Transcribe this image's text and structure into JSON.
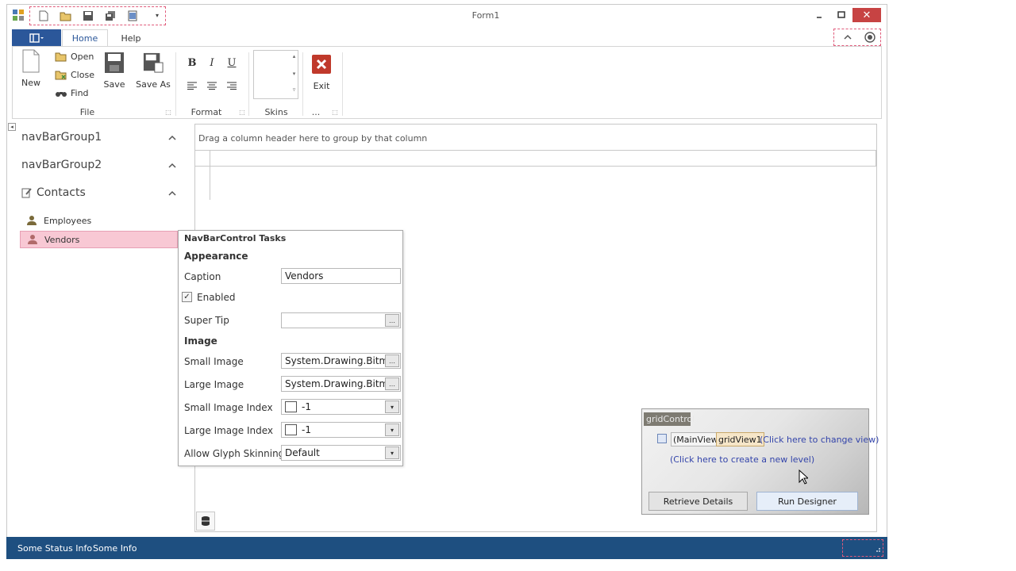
{
  "window": {
    "title": "Form1",
    "minimize_icon": "minimize-icon",
    "maximize_icon": "maximize-icon",
    "close_icon": "close-icon"
  },
  "quick_access": [
    "new-doc-icon",
    "open-folder-icon",
    "save-icon",
    "save-all-icon",
    "print-icon",
    "customize-dropdown-icon"
  ],
  "ribbon": {
    "tabs": [
      {
        "label": "Home",
        "active": true
      },
      {
        "label": "Help",
        "active": false
      }
    ],
    "groups": {
      "file": {
        "label": "File",
        "new_label": "New",
        "open_label": "Open",
        "close_label": "Close",
        "find_label": "Find",
        "save_label": "Save",
        "save_as_label": "Save As"
      },
      "format": {
        "label": "Format",
        "bold": "B",
        "italic": "I",
        "underline": "U"
      },
      "skins": {
        "label": "Skins"
      },
      "exit": {
        "label": "...",
        "exit_label": "Exit"
      }
    }
  },
  "navbar": {
    "groups": [
      {
        "label": "navBarGroup1"
      },
      {
        "label": "navBarGroup2"
      },
      {
        "label": "Contacts"
      }
    ],
    "items": [
      {
        "label": "Employees",
        "selected": false
      },
      {
        "label": "Vendors",
        "selected": true
      }
    ]
  },
  "grid": {
    "group_panel_text": "Drag a column header here to group by that column"
  },
  "tasks_panel": {
    "title": "NavBarControl Tasks",
    "appearance_heading": "Appearance",
    "caption_label": "Caption",
    "caption_value": "Vendors",
    "enabled_label": "Enabled",
    "enabled_checked": true,
    "super_tip_label": "Super Tip",
    "super_tip_value": "",
    "image_heading": "Image",
    "small_image_label": "Small Image",
    "small_image_value": "System.Drawing.Bitma",
    "large_image_label": "Large Image",
    "large_image_value": "System.Drawing.Bitma",
    "small_image_index_label": "Small Image Index",
    "small_image_index_value": "-1",
    "large_image_index_label": "Large Image Index",
    "large_image_index_value": "-1",
    "glyph_skinning_label": "Allow Glyph Skinning",
    "glyph_skinning_value": "Default"
  },
  "designer": {
    "tag": "gridControl",
    "main_view": "(MainView)",
    "view_name": "gridView1",
    "change_view_link": "(Click here to change view)",
    "new_level_link": "(Click here to create a new level)",
    "retrieve_details_label": "Retrieve Details",
    "run_designer_label": "Run Designer"
  },
  "statusbar": {
    "items": [
      "Some Status Info",
      "Some Info"
    ],
    "color": "#1e4f80"
  },
  "colors": {
    "accent": "#2b579a",
    "selected_item": "#f8c8d4",
    "close_button": "#c74343",
    "link": "#3344aa"
  }
}
